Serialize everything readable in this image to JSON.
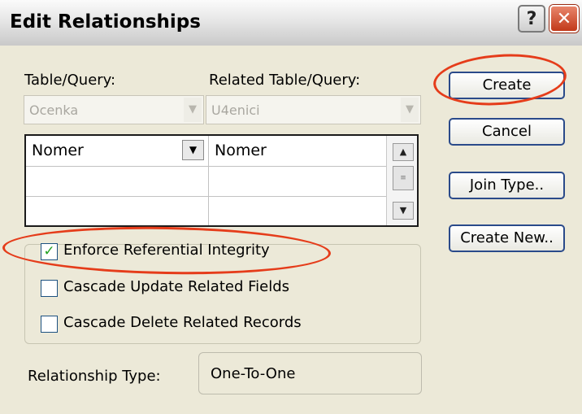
{
  "window": {
    "title": "Edit Relationships",
    "help_glyph": "?",
    "close_glyph": "✕"
  },
  "labels": {
    "table_query": "Table/Query:",
    "related_table_query": "Related Table/Query:",
    "relationship_type": "Relationship Type:"
  },
  "combos": {
    "table_query_value": "Ocenka",
    "related_table_query_value": "U4enici"
  },
  "field_grid": {
    "rows": [
      {
        "left": "Nomer",
        "right": "Nomer"
      },
      {
        "left": "",
        "right": ""
      },
      {
        "left": "",
        "right": ""
      }
    ]
  },
  "checkboxes": {
    "enforce_referential_integrity": {
      "label": "Enforce Referential Integrity",
      "checked": true
    },
    "cascade_update": {
      "label": "Cascade Update Related Fields",
      "checked": false
    },
    "cascade_delete": {
      "label": "Cascade Delete Related Records",
      "checked": false
    }
  },
  "buttons": {
    "create": "Create",
    "cancel": "Cancel",
    "join_type": "Join Type..",
    "create_new": "Create New.."
  },
  "relationship_type_value": "One-To-One",
  "icons": {
    "dropdown": "chevron-down-icon",
    "scroll_up": "arrow-up-icon",
    "scroll_down": "arrow-down-icon",
    "check": "checkmark-icon"
  },
  "colors": {
    "annotation": "#e53c1a",
    "dialog_bg": "#ece9d8",
    "button_border": "#2a4a8a",
    "checkmark": "#21a121"
  }
}
